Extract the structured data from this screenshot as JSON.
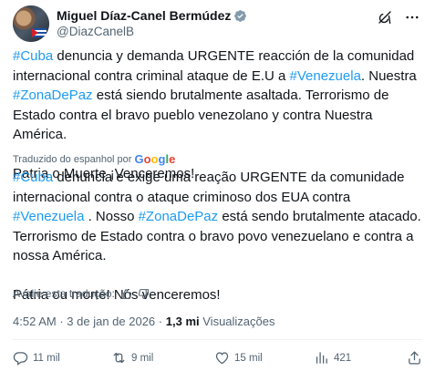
{
  "author": {
    "name": "Miguel Díaz-Canel Bermúdez",
    "handle": "@DiazCanelB"
  },
  "original": {
    "segments1": [
      {
        "t": "#Cuba",
        "tag": true
      },
      {
        "t": " denuncia y demanda URGENTE reacción de la comunidad internacional contra criminal ataque de E.U a ",
        "tag": false
      },
      {
        "t": "#Venezuela",
        "tag": true
      },
      {
        "t": ". Nuestra ",
        "tag": false
      },
      {
        "t": "#ZonaDePaz",
        "tag": true
      },
      {
        "t": " está siendo brutalmente asaltada. Terrorismo de Estado contra el bravo pueblo venezolano y contra Nuestra América.",
        "tag": false
      }
    ],
    "closing": "Patria o Muerte ¡Venceremos!"
  },
  "translation": {
    "label": "Traduzido do espanhol por",
    "provider": "Google",
    "segments1": [
      {
        "t": "#Cuba",
        "tag": true
      },
      {
        "t": " denuncia e exige uma reação URGENTE da comunidade internacional contra o ataque criminoso dos EUA contra ",
        "tag": false
      },
      {
        "t": "#Venezuela",
        "tag": true
      },
      {
        "t": " . Nosso ",
        "tag": false
      },
      {
        "t": "#ZonaDePaz",
        "tag": true
      },
      {
        "t": " está sendo brutalmente atacado. Terrorismo de Estado contra o bravo povo venezuelano e contra a nossa América.",
        "tag": false
      }
    ],
    "closing": "Pátria ou morte! Nós venceremos!"
  },
  "rating": {
    "label": "Avalie esta tradução:"
  },
  "meta": {
    "time": "4:52 AM",
    "sep": "·",
    "date": "3 de jan de 2026",
    "views_count": "1,3 mi",
    "views_label": "Visualizações"
  },
  "actions": {
    "reply": "11 mil",
    "retweet": "9 mil",
    "like": "15 mil",
    "views": "421"
  },
  "colors": {
    "accent": "#1d9bf0",
    "text": "#0f1419",
    "muted": "#536471"
  },
  "icons": {
    "verified": "verified-badge-icon",
    "grok": "grok-icon",
    "more": "more-icon",
    "thumbs_up": "thumbs-up-icon",
    "thumbs_down": "thumbs-down-icon",
    "reply": "reply-icon",
    "retweet": "retweet-icon",
    "like": "heart-icon",
    "views": "views-icon",
    "bookmark": "bookmark-icon",
    "share": "share-icon"
  }
}
